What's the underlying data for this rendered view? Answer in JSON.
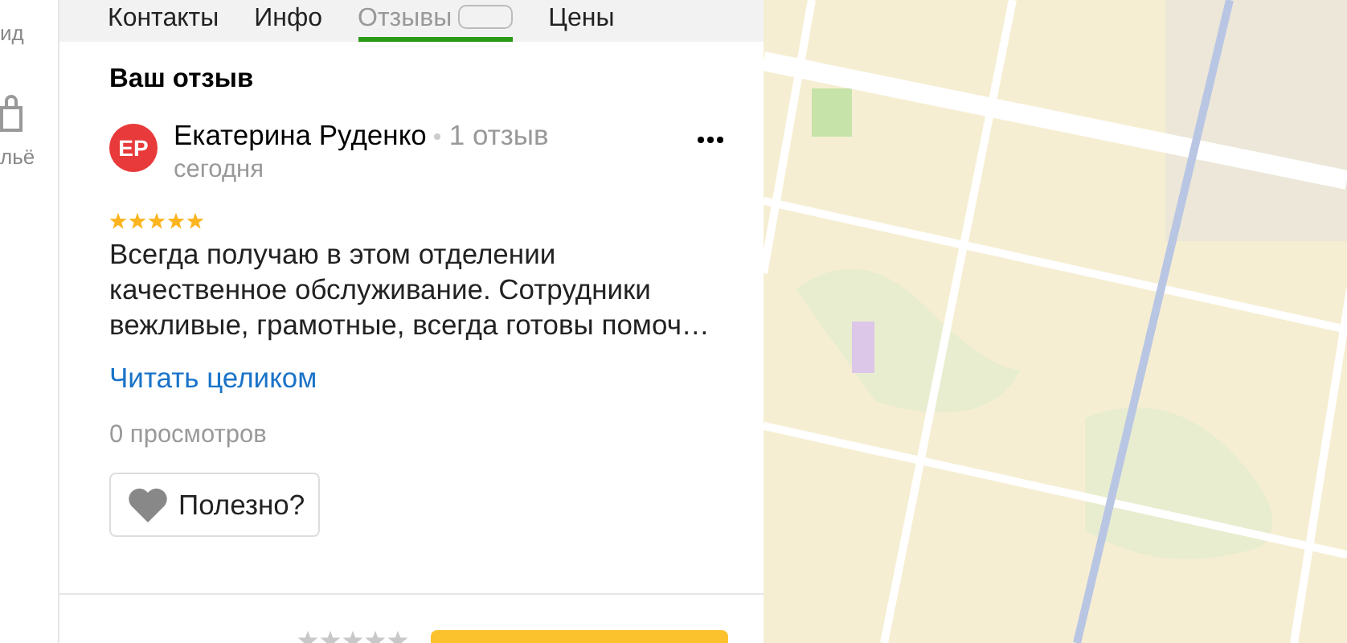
{
  "sidebar": {
    "items": [
      {
        "kind": "text",
        "label": "ид"
      },
      {
        "kind": "with_icon",
        "label": "льё"
      }
    ]
  },
  "tabs": [
    {
      "label": "Контакты",
      "selected": false
    },
    {
      "label": "Инфо",
      "selected": false
    },
    {
      "label": "Отзывы",
      "selected": true,
      "badge": true
    },
    {
      "label": "Цены",
      "selected": false
    }
  ],
  "review_section": {
    "title": "Ваш отзыв",
    "review": {
      "avatar_initials": "ЕР",
      "author": "Екатерина Руденко",
      "review_count": "1 отзыв",
      "date": "сегодня",
      "stars": 5,
      "text": "Всегда получаю в этом отделении качественное обслуживание. Сотрудники вежливые, грамотные, всегда готовы помоч…",
      "read_more": "Читать целиком",
      "views": "0 просмотров",
      "helpful_button": "Полезно?"
    }
  },
  "rating": {
    "stars": 0
  }
}
